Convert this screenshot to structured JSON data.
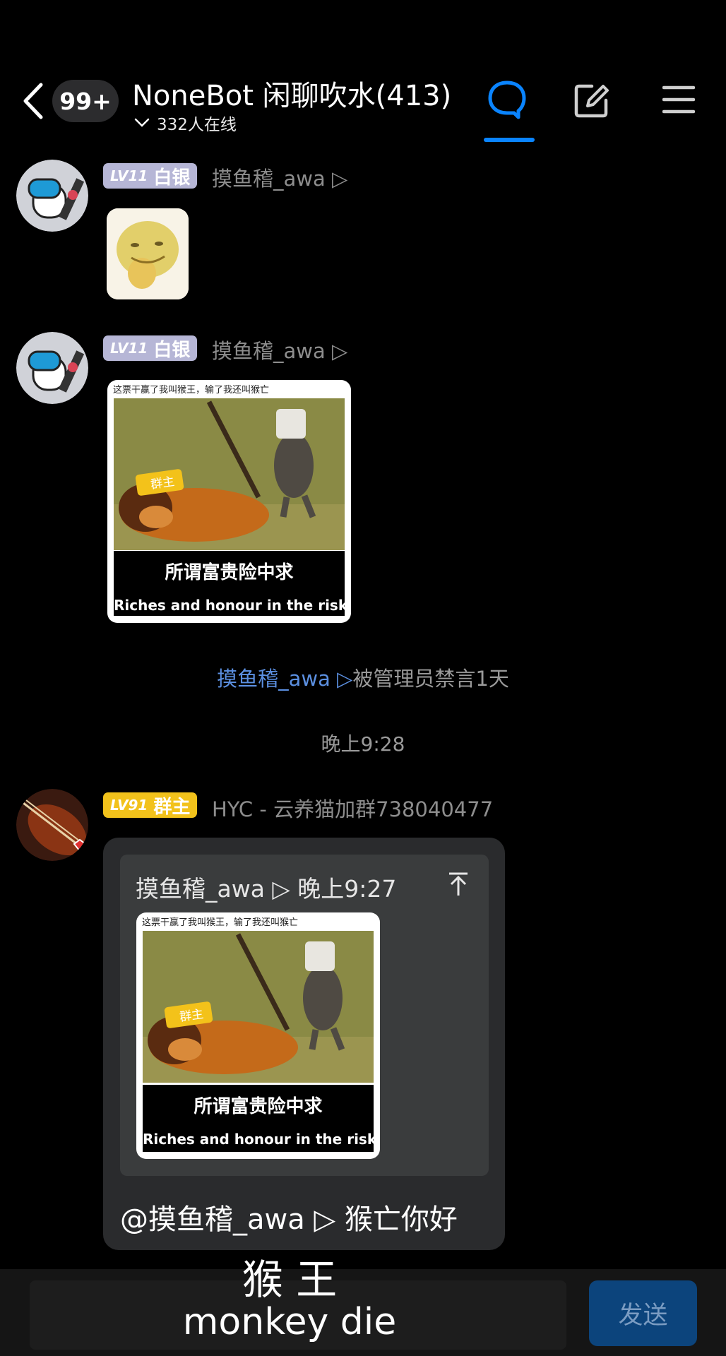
{
  "header": {
    "unread_count": "99+",
    "group_title": "NoneBot 闲聊吹水(413)",
    "online_text": "332人在线",
    "icons": [
      "back-arrow-icon",
      "chat-bubble-icon",
      "edit-icon",
      "menu-icon"
    ],
    "accent_color": "#0a84ff"
  },
  "messages": [
    {
      "level": "LV11",
      "title": "白银",
      "sender": "摸鱼稽_awa ▷",
      "content": "sticker"
    },
    {
      "level": "LV11",
      "title": "白银",
      "sender": "摸鱼稽_awa ▷",
      "meme": {
        "top_caption": "这票干赢了我叫猴王，输了我还叫猴亡",
        "label": "群主",
        "zh_caption": "所谓富贵险中求",
        "en_caption": "Riches and honour in the risk"
      }
    },
    {
      "level": "LV91",
      "title": "群主",
      "sender": "HYC - 云养猫加群738040477",
      "quote": {
        "header": "摸鱼稽_awa ▷ 晚上9:27"
      },
      "reply_text": "@摸鱼稽_awa ▷ 猴亡你好"
    }
  ],
  "system_notice": {
    "who": "摸鱼稽_awa ▷",
    "text": "被管理员禁言1天"
  },
  "timestamp": "晚上9:28",
  "composer": {
    "send_label": "发送"
  },
  "subtitles": {
    "line1": "猴 王",
    "line2": "monkey die"
  }
}
